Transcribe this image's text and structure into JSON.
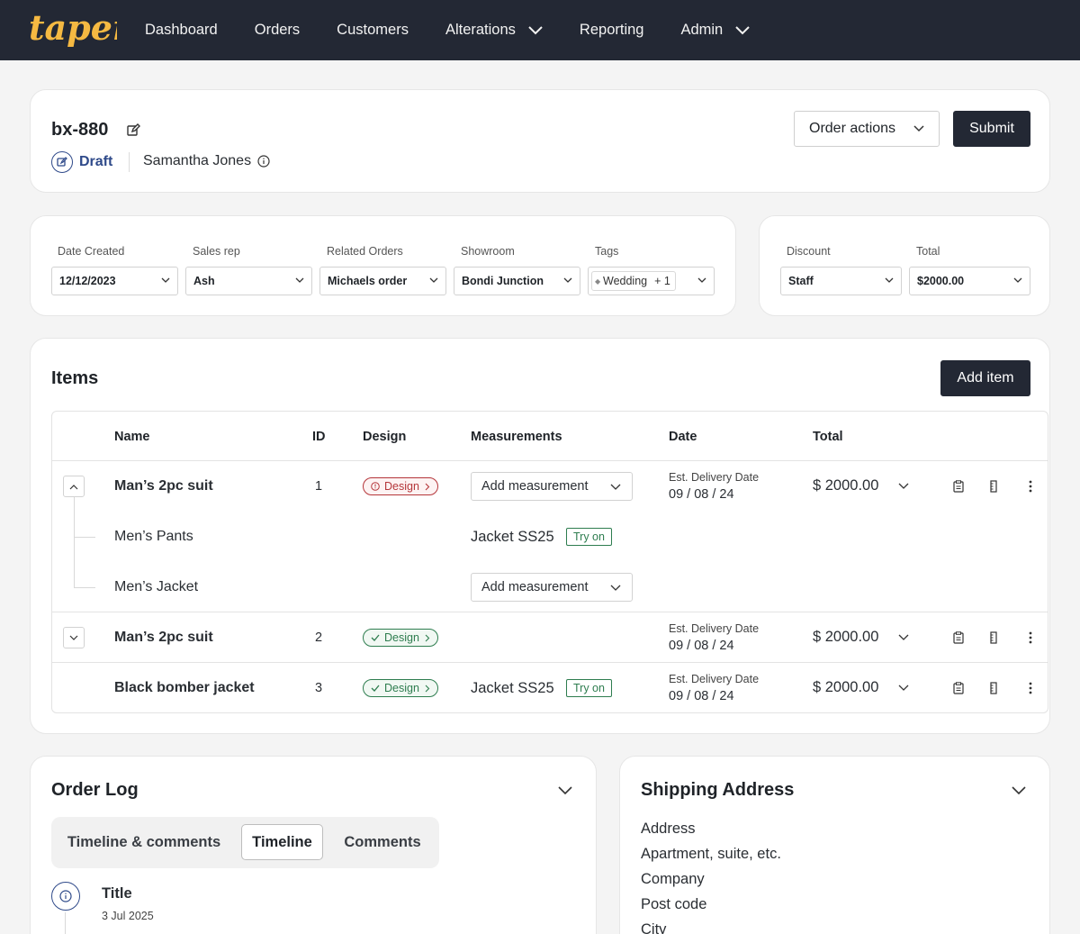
{
  "brand": {
    "logo_text": "taper",
    "accent": "#f5b942",
    "nav_bg": "#232834"
  },
  "nav": {
    "items": [
      {
        "label": "Dashboard"
      },
      {
        "label": "Orders"
      },
      {
        "label": "Customers"
      },
      {
        "label": "Alterations"
      },
      {
        "label": "Reporting"
      },
      {
        "label": "Admin"
      }
    ]
  },
  "order": {
    "id": "bx-880",
    "status": "Draft",
    "customer": "Samantha Jones",
    "actions_label": "Order actions",
    "submit_label": "Submit"
  },
  "fields": {
    "date_created": {
      "label": "Date Created",
      "value": "12/12/2023"
    },
    "sales_rep": {
      "label": "Sales rep",
      "value": "Ash"
    },
    "related_orders": {
      "label": "Related Orders",
      "value": "Michaels order"
    },
    "showroom": {
      "label": "Showroom",
      "value": "Bondi Junction"
    },
    "tags": {
      "label": "Tags",
      "chip": "Wedding",
      "more": "+ 1"
    },
    "discount": {
      "label": "Discount",
      "value": "Staff"
    },
    "total": {
      "label": "Total",
      "value": "$2000.00"
    }
  },
  "items": {
    "title": "Items",
    "add_label": "Add item",
    "columns": [
      "Name",
      "ID",
      "Design",
      "Measurements",
      "Date",
      "Total"
    ],
    "design_label": "Design",
    "add_measurement": "Add measurement",
    "est_label": "Est. Delivery Date",
    "try_on": "Try on",
    "rows": [
      {
        "name": "Man’s 2pc suit",
        "id": "1",
        "design_status": "warning",
        "date": "09 / 08 / 24",
        "total": "$ 2000.00",
        "children": [
          {
            "name": "Men’s Pants",
            "measurement": "Jacket SS25"
          },
          {
            "name": "Men’s Jacket"
          }
        ]
      },
      {
        "name": "Man’s 2pc suit",
        "id": "2",
        "design_status": "done",
        "date": "09 / 08 / 24",
        "total": "$ 2000.00"
      },
      {
        "name": "Black bomber jacket",
        "id": "3",
        "design_status": "done",
        "measurement": "Jacket SS25",
        "date": "09 / 08 / 24",
        "total": "$ 2000.00"
      }
    ]
  },
  "order_log": {
    "title": "Order Log",
    "tabs": [
      {
        "label": "Timeline & comments"
      },
      {
        "label": "Timeline"
      },
      {
        "label": "Comments"
      }
    ],
    "active_tab": "Timeline",
    "entries": [
      {
        "title": "Title",
        "date": "3 Jul 2025"
      }
    ]
  },
  "shipping": {
    "title": "Shipping Address",
    "fields": [
      "Address",
      "Apartment, suite, etc.",
      "Company",
      "Post code",
      "City"
    ]
  }
}
